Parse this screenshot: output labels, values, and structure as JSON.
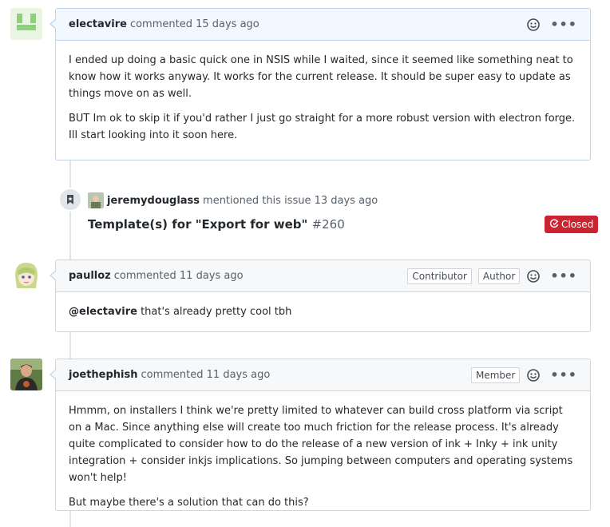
{
  "comments": [
    {
      "author": "electavire",
      "meta": "commented 15 days ago",
      "paragraphs": [
        "I ended up doing a basic quick one in NSIS while I waited, since it seemed like something neat to know how it works anyway. It works for the current release. It should be super easy to update as things move on as well.",
        "BUT Im ok to skip it if you'd rather I just go straight for a more robust version with electron forge. Ill start looking into it soon here."
      ]
    },
    {
      "author": "paulloz",
      "meta": "commented 11 days ago",
      "labels": [
        "Contributor",
        "Author"
      ],
      "mention": "@electavire",
      "text": " that's already pretty cool tbh"
    },
    {
      "author": "joethephish",
      "meta": "commented 11 days ago",
      "labels": [
        "Member"
      ],
      "paragraphs": [
        "Hmmm, on installers I think we're pretty limited to whatever can build cross platform via script on a Mac. Since anything else will create too much friction for the release process. It's already quite complicated to consider how to do the release of a new version of ink + Inky + ink unity integration + consider inkjs implications. So jumping between computers and operating systems won't help!",
        "But maybe there's a solution that can do this?"
      ]
    }
  ],
  "event": {
    "author": "jeremydouglass",
    "meta": "mentioned this issue 13 days ago",
    "title": "Template(s) for \"Export for web\"",
    "number": "#260",
    "status": "Closed"
  },
  "icons": {
    "reaction": "smiley-icon",
    "menu": "kebab-horizontal-icon",
    "event": "bookmark-icon",
    "closed": "issue-closed-icon"
  },
  "colors": {
    "closed": "#cb2431",
    "own_header": "#f1f8ff",
    "header": "#f6f8fa"
  }
}
